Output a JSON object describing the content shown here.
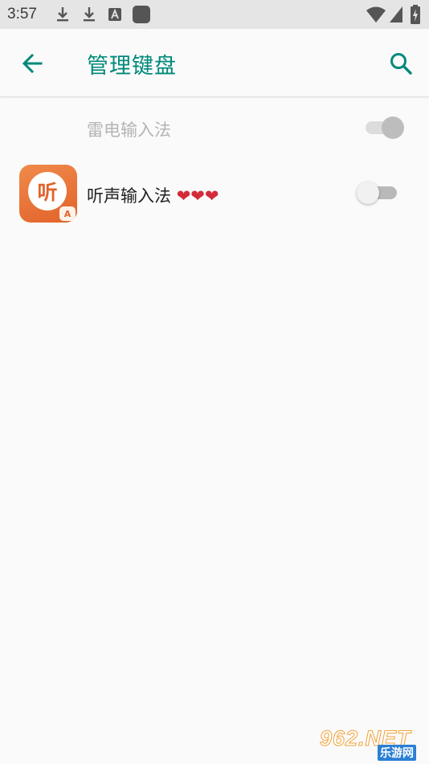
{
  "status_bar": {
    "time": "3:57",
    "left_icons": [
      "download-icon",
      "download-icon",
      "keyboard-a-icon",
      "app-square-icon"
    ],
    "right_icons": [
      "wifi-icon",
      "signal-icon",
      "battery-charging-icon"
    ]
  },
  "app_bar": {
    "title": "管理键盘",
    "back_icon": "arrow-left-icon",
    "search_icon": "search-icon",
    "accent_color": "#00897b"
  },
  "keyboards": [
    {
      "label": "雷电输入法",
      "enabled": true,
      "disabled_state": true
    },
    {
      "label": "听声输入法 ",
      "hearts": "❤❤❤",
      "enabled": false,
      "icon_text": "听",
      "icon_badge": "A"
    }
  ],
  "watermark": {
    "main": "962.NET",
    "sub": "乐游网"
  }
}
